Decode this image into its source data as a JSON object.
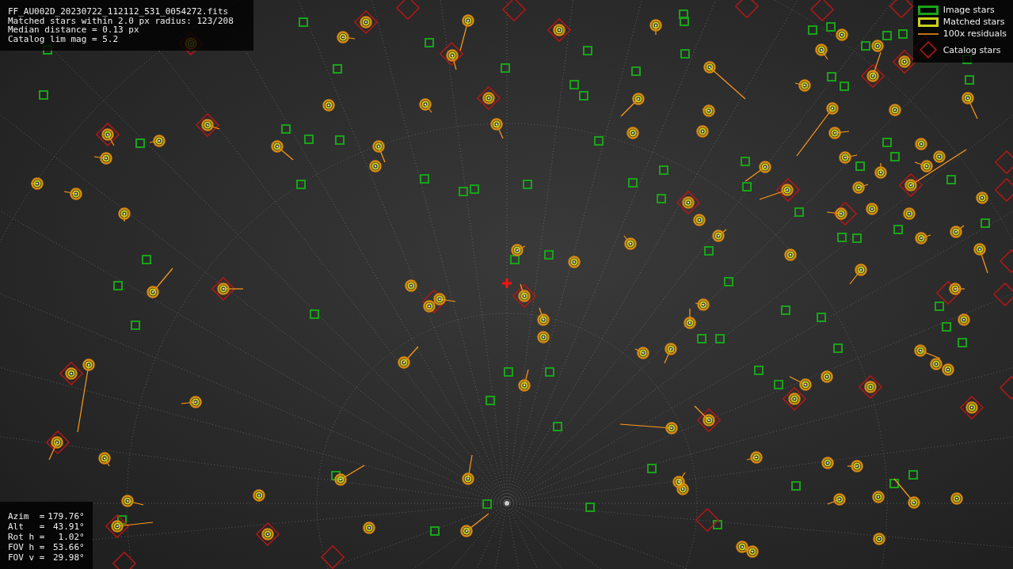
{
  "info": {
    "lines": [
      "FF_AU002D_20230722_112112_531_0054272.fits",
      "Matched stars within 2.0 px radius: 123/208",
      "Median distance = 0.13 px",
      "Catalog lim mag = 5.2"
    ]
  },
  "legend": [
    {
      "kind": "image",
      "label": "Image stars"
    },
    {
      "kind": "matched",
      "label": "Matched stars"
    },
    {
      "kind": "residual",
      "label": "100x residuals"
    },
    {
      "kind": "catalog",
      "label": "Catalog stars"
    }
  ],
  "pointing": [
    {
      "label": "Azim  =",
      "value": "179.76°"
    },
    {
      "label": "Alt   =",
      "value": "43.91°"
    },
    {
      "label": "Rot h =",
      "value": "1.02°"
    },
    {
      "label": "FOV h =",
      "value": "53.66°"
    },
    {
      "label": "FOV v =",
      "value": "29.98°"
    }
  ]
}
